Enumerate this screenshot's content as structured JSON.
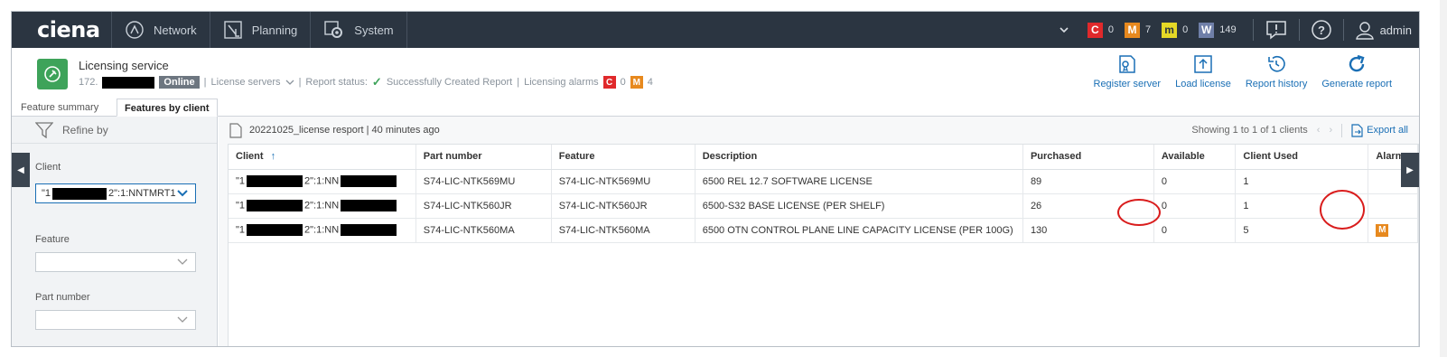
{
  "topbar": {
    "logo": "ciena",
    "nav": [
      {
        "label": "Network",
        "icon": "network-icon"
      },
      {
        "label": "Planning",
        "icon": "planning-icon"
      },
      {
        "label": "System",
        "icon": "system-gear-icon"
      }
    ],
    "alarm_counts": [
      {
        "sev": "C",
        "count": "0",
        "color": "#e0292b"
      },
      {
        "sev": "M",
        "count": "7",
        "color": "#e7891e"
      },
      {
        "sev": "m",
        "count": "0",
        "color": "#e5d826"
      },
      {
        "sev": "W",
        "count": "149",
        "color": "#6f7fa8"
      }
    ],
    "user": "admin"
  },
  "service": {
    "title": "Licensing service",
    "ip_prefix": "172.",
    "status_badge": "Online",
    "license_servers": "License servers",
    "report_status_label": "Report status:",
    "report_status_value": "Successfully Created Report",
    "licensing_alarms_label": "Licensing alarms",
    "alarm_c": "C",
    "alarm_c_count": "0",
    "alarm_m": "M",
    "alarm_m_count": "4"
  },
  "actions": {
    "register_server": "Register server",
    "load_license": "Load license",
    "report_history": "Report history",
    "generate_report": "Generate report"
  },
  "tabs": {
    "feature_summary": "Feature summary",
    "features_by_client": "Features by client"
  },
  "filters": {
    "refine_by": "Refine by",
    "client_label": "Client",
    "client_value_prefix": "\"1",
    "client_value_suffix": "2\":1:NNTMRT1",
    "feature_label": "Feature",
    "part_number_label": "Part number"
  },
  "report": {
    "file_name": "20221025_license resport | 40 minutes ago",
    "showing": "Showing 1 to 1 of 1 clients",
    "export_all": "Export all"
  },
  "table": {
    "headers": {
      "client": "Client",
      "part_number": "Part number",
      "feature": "Feature",
      "description": "Description",
      "purchased": "Purchased",
      "available": "Available",
      "client_used": "Client Used",
      "alarms": "Alarms"
    },
    "rows": [
      {
        "client_a": "\"1",
        "client_b": "2\":1:NN",
        "part_number": "S74-LIC-NTK569MU",
        "feature": "S74-LIC-NTK569MU",
        "description": "6500 REL 12.7 SOFTWARE LICENSE",
        "purchased": "89",
        "available": "0",
        "client_used": "1",
        "alarm": ""
      },
      {
        "client_a": "\"1",
        "client_b": "2\":1:NN",
        "part_number": "S74-LIC-NTK560JR",
        "feature": "S74-LIC-NTK560JR",
        "description": "6500-S32 BASE LICENSE (PER SHELF)",
        "purchased": "26",
        "available": "0",
        "client_used": "1",
        "alarm": ""
      },
      {
        "client_a": "\"1",
        "client_b": "2\":1:NN",
        "part_number": "S74-LIC-NTK560MA",
        "feature": "S74-LIC-NTK560MA",
        "description": "6500 OTN CONTROL PLANE LINE CAPACITY LICENSE (PER 100G)",
        "purchased": "130",
        "available": "0",
        "client_used": "5",
        "alarm": "M"
      }
    ]
  }
}
